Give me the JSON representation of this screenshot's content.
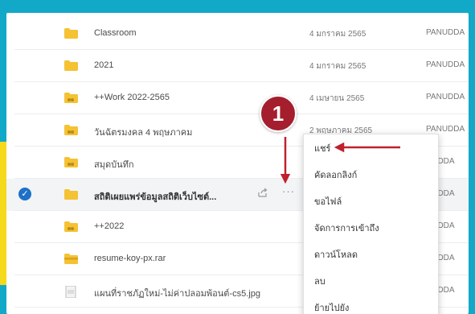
{
  "files": [
    {
      "name": "Classroom",
      "date": "4 มกราคม 2565",
      "owner": "PANUDDA",
      "icon": "folder-icon",
      "shared": false,
      "selected": false
    },
    {
      "name": "2021",
      "date": "4 มกราคม 2565",
      "owner": "PANUDDA",
      "icon": "folder-icon",
      "shared": false,
      "selected": false
    },
    {
      "name": "++Work 2022-2565",
      "date": "4 เมษายน 2565",
      "owner": "PANUDDA",
      "icon": "shared-folder-icon",
      "shared": true,
      "selected": false
    },
    {
      "name": "วันฉัตรมงคล 4 พฤษภาคม",
      "date": "2 พฤษภาคม 2565",
      "owner": "PANUDDA",
      "icon": "shared-folder-icon",
      "shared": true,
      "selected": false
    },
    {
      "name": "สมุดบันทึก",
      "date": "",
      "owner": "NUDDA",
      "icon": "shared-folder-icon",
      "shared": true,
      "selected": false
    },
    {
      "name": "สถิติเผยแพร่ข้อมูลสถิติเว็บไซต์...",
      "date": "",
      "owner": "NUDDA",
      "icon": "folder-icon",
      "shared": false,
      "selected": true
    },
    {
      "name": "++2022",
      "date": "",
      "owner": "NUDDA",
      "icon": "shared-folder-icon",
      "shared": true,
      "selected": false
    },
    {
      "name": "resume-koy-px.rar",
      "date": "",
      "owner": "NUDDA",
      "icon": "archive-icon",
      "shared": false,
      "selected": false
    },
    {
      "name": "แผนที่ราชภัฏใหม่-ไม่ค่าปลอมพ้อนต์-cs5.jpg",
      "date": "",
      "owner": "NUDDA",
      "icon": "image-file-icon",
      "shared": false,
      "selected": false
    }
  ],
  "selected_row": {
    "check": "✓",
    "share_icon": "share-icon",
    "more_icon": "more-options-icon",
    "more_label": "···"
  },
  "context_menu": {
    "items": [
      "แชร์",
      "คัดลอกลิงก์",
      "ขอไฟล์",
      "จัดการการเข้าถึง",
      "ดาวน์โหลด",
      "ลบ",
      "ย้ายไปยัง"
    ]
  },
  "annotation": {
    "step_number": "1",
    "badge_color": "#a51e2d",
    "arrow_color": "#c0202e"
  },
  "colors": {
    "frame": "#12a9c9",
    "edge_accent": "#f5d91b",
    "folder": "#f5c234",
    "selected_check": "#1e70c8"
  }
}
